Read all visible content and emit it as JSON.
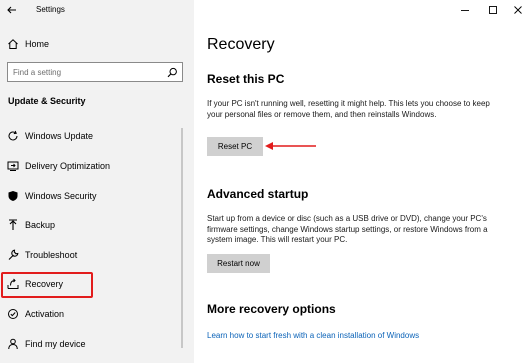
{
  "window": {
    "title": "Settings",
    "controls": [
      "minimize-icon",
      "maximize-icon",
      "close-icon"
    ]
  },
  "sidebar": {
    "home_label": "Home",
    "search_placeholder": "Find a setting",
    "section_heading": "Update & Security",
    "items": [
      {
        "label": "Windows Update",
        "icon": "sync-icon"
      },
      {
        "label": "Delivery Optimization",
        "icon": "delivery-icon"
      },
      {
        "label": "Windows Security",
        "icon": "shield-icon"
      },
      {
        "label": "Backup",
        "icon": "backup-icon"
      },
      {
        "label": "Troubleshoot",
        "icon": "wrench-icon"
      },
      {
        "label": "Recovery",
        "icon": "recovery-icon",
        "selected": true
      },
      {
        "label": "Activation",
        "icon": "activation-icon"
      },
      {
        "label": "Find my device",
        "icon": "person-icon"
      }
    ]
  },
  "main": {
    "title": "Recovery",
    "reset": {
      "heading": "Reset this PC",
      "description": "If your PC isn't running well, resetting it might help. This lets you choose to keep your personal files or remove them, and then reinstalls Windows.",
      "button_label": "Reset PC"
    },
    "advanced": {
      "heading": "Advanced startup",
      "description": "Start up from a device or disc (such as a USB drive or DVD), change your PC's firmware settings, change Windows startup settings, or restore Windows from a system image. This will restart your PC.",
      "button_label": "Restart now"
    },
    "more": {
      "heading": "More recovery options",
      "link_text": "Learn how to start fresh with a clean installation of Windows"
    }
  },
  "colors": {
    "annotation_red": "#e21c1c",
    "link_blue": "#0b63b8",
    "sidebar_bg": "#f2f2f2",
    "button_bg": "#d0d0d0"
  }
}
